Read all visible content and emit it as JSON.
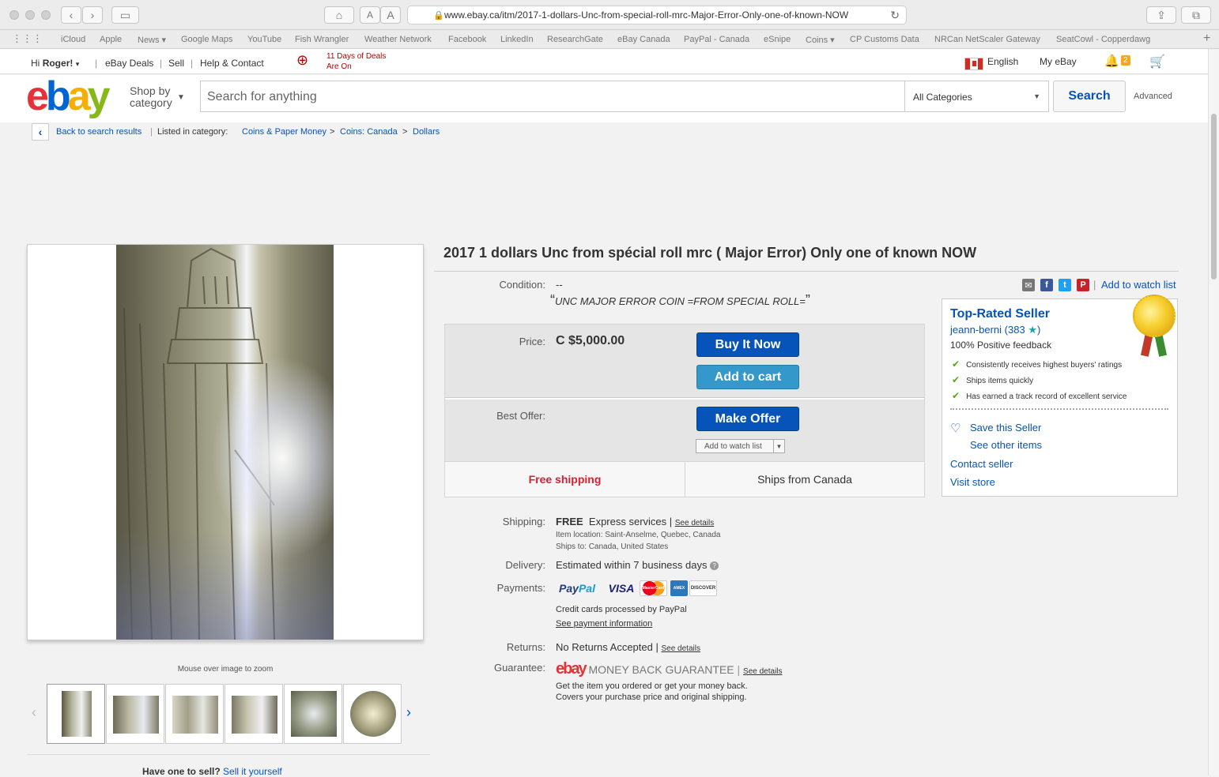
{
  "browser": {
    "url": "www.ebay.ca/itm/2017-1-dollars-Unc-from-special-roll-mrc-Major-Error-Only-one-of-known-NOW",
    "bookmarks": [
      "iCloud",
      "Apple",
      "News ▾",
      "Google Maps",
      "YouTube",
      "Fish Wrangler",
      "Weather Network",
      "Facebook",
      "LinkedIn",
      "ResearchGate",
      "eBay Canada",
      "PayPal - Canada",
      "eSnipe",
      "Coins ▾",
      "CP Customs Data",
      "NRCan NetScaler Gateway",
      "SeatCowl - Copperdawg"
    ],
    "reader_small": "A",
    "reader_large": "A"
  },
  "top_nav": {
    "greeting": "Hi",
    "user": "Roger!",
    "ebay_deals": "eBay Deals",
    "sell": "Sell",
    "help": "Help & Contact",
    "promo_line1": "11 Days of Deals",
    "promo_line2": "Are On",
    "language": "English",
    "my_ebay": "My eBay",
    "notification_count": "2"
  },
  "header": {
    "logo_e": "e",
    "logo_b": "b",
    "logo_a": "a",
    "logo_y": "y",
    "shop_by_1": "Shop by",
    "shop_by_2": "category",
    "search_placeholder": "Search for anything",
    "category": "All Categories",
    "search_label": "Search",
    "advanced": "Advanced"
  },
  "breadcrumb": {
    "back": "Back to search results",
    "listed": "Listed in category:",
    "c1": "Coins & Paper Money",
    "c2": "Coins: Canada",
    "c3": "Dollars"
  },
  "gallery": {
    "zoom_note": "Mouse over image to zoom",
    "thumb_count": 6
  },
  "sell_promo": {
    "question": "Have one to sell?",
    "link": "Sell it yourself"
  },
  "item": {
    "title": "2017 1 dollars Unc from spécial roll mrc ( Major Error) Only one of known NOW",
    "condition_label": "Condition:",
    "condition_value": "--",
    "condition_note": "UNC MAJOR ERROR COIN =FROM SPECIAL ROLL=",
    "add_to_watch": "Add to watch list",
    "price_label": "Price:",
    "price": "C $5,000.00",
    "buy_now": "Buy It Now",
    "add_to_cart": "Add to cart",
    "best_offer_label": "Best Offer:",
    "make_offer": "Make Offer",
    "watch_small": "Add to watch list",
    "free_shipping": "Free shipping",
    "ships_from": "Ships from Canada"
  },
  "details": {
    "shipping_label": "Shipping:",
    "shipping_free": "FREE",
    "shipping_service": "Express services",
    "see_details": "See details",
    "item_location": "Item location:  Saint-Anselme, Quebec, Canada",
    "ships_to": "Ships to:  Canada, United States",
    "delivery_label": "Delivery:",
    "delivery_value": "Estimated within 7 business days",
    "payments_label": "Payments:",
    "paypal_pay": "Pay",
    "paypal_pal": "Pal",
    "visa": "VISA",
    "mastercard": "MasterCard",
    "amex": "AMEX",
    "discover": "DISCOVER",
    "cc_note": "Credit cards processed by PayPal",
    "payment_info": "See payment information",
    "returns_label": "Returns:",
    "returns_value": "No Returns Accepted",
    "guarantee_label": "Guarantee:",
    "guarantee_brand": "ebay",
    "guarantee_text": "MONEY BACK GUARANTEE",
    "guarantee_line1": "Get the item you ordered or get your money back.",
    "guarantee_line2": "Covers your purchase price and original shipping."
  },
  "seller": {
    "title": "Top-Rated Seller",
    "name": "jeann-berni",
    "score": "383",
    "positive": "100% Positive feedback",
    "check1": "Consistently receives highest buyers' ratings",
    "check2": "Ships items quickly",
    "check3": "Has earned a track record of excellent service",
    "save": "Save this Seller",
    "other": "See other items",
    "contact": "Contact seller",
    "store": "Visit store"
  }
}
